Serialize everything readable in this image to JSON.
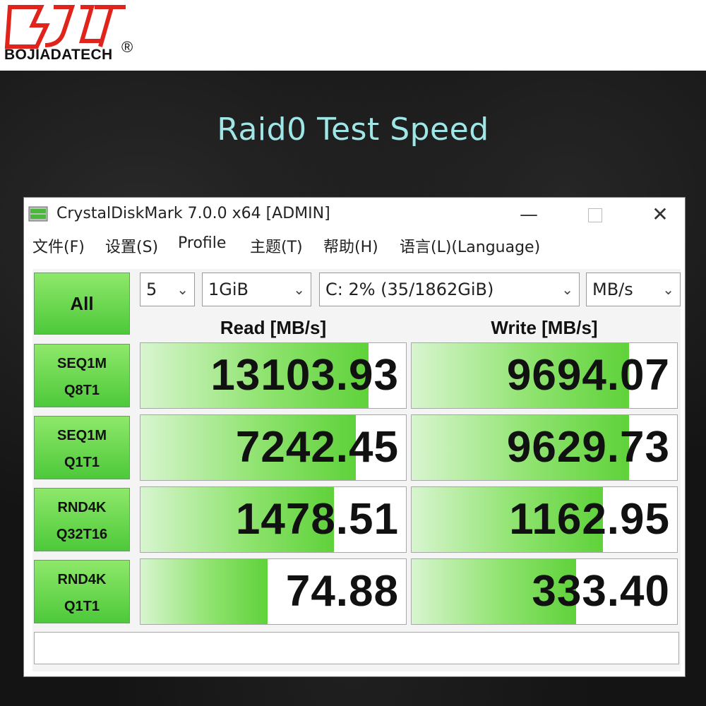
{
  "brand": {
    "name": "BOJIADATECH",
    "registered": "®",
    "logo_text": "BJLT"
  },
  "headline": "Raid0 Test Speed",
  "window": {
    "title": "CrystalDiskMark 7.0.0 x64 [ADMIN]",
    "controls": {
      "minimize": "—",
      "close": "✕"
    }
  },
  "menu": [
    "文件(F)",
    "设置(S)",
    "Profile",
    "主题(T)",
    "帮助(H)",
    "语言(L)(Language)"
  ],
  "toolbar": {
    "all_label": "All",
    "count": "5",
    "size": "1GiB",
    "drive": "C: 2% (35/1862GiB)",
    "unit": "MB/s"
  },
  "headers": {
    "read": "Read [MB/s]",
    "write": "Write [MB/s]"
  },
  "tests": [
    {
      "line1": "SEQ1M",
      "line2": "Q8T1",
      "read": "13103.93",
      "write": "9694.07",
      "read_bar": 0.86,
      "write_bar": 0.82
    },
    {
      "line1": "SEQ1M",
      "line2": "Q1T1",
      "read": "7242.45",
      "write": "9629.73",
      "read_bar": 0.81,
      "write_bar": 0.82
    },
    {
      "line1": "RND4K",
      "line2": "Q32T16",
      "read": "1478.51",
      "write": "1162.95",
      "read_bar": 0.73,
      "write_bar": 0.72
    },
    {
      "line1": "RND4K",
      "line2": "Q1T1",
      "read": "74.88",
      "write": "333.40",
      "read_bar": 0.48,
      "write_bar": 0.62
    }
  ],
  "colors": {
    "accent_green": "#5fd23a",
    "headline": "#9fe6e6"
  }
}
